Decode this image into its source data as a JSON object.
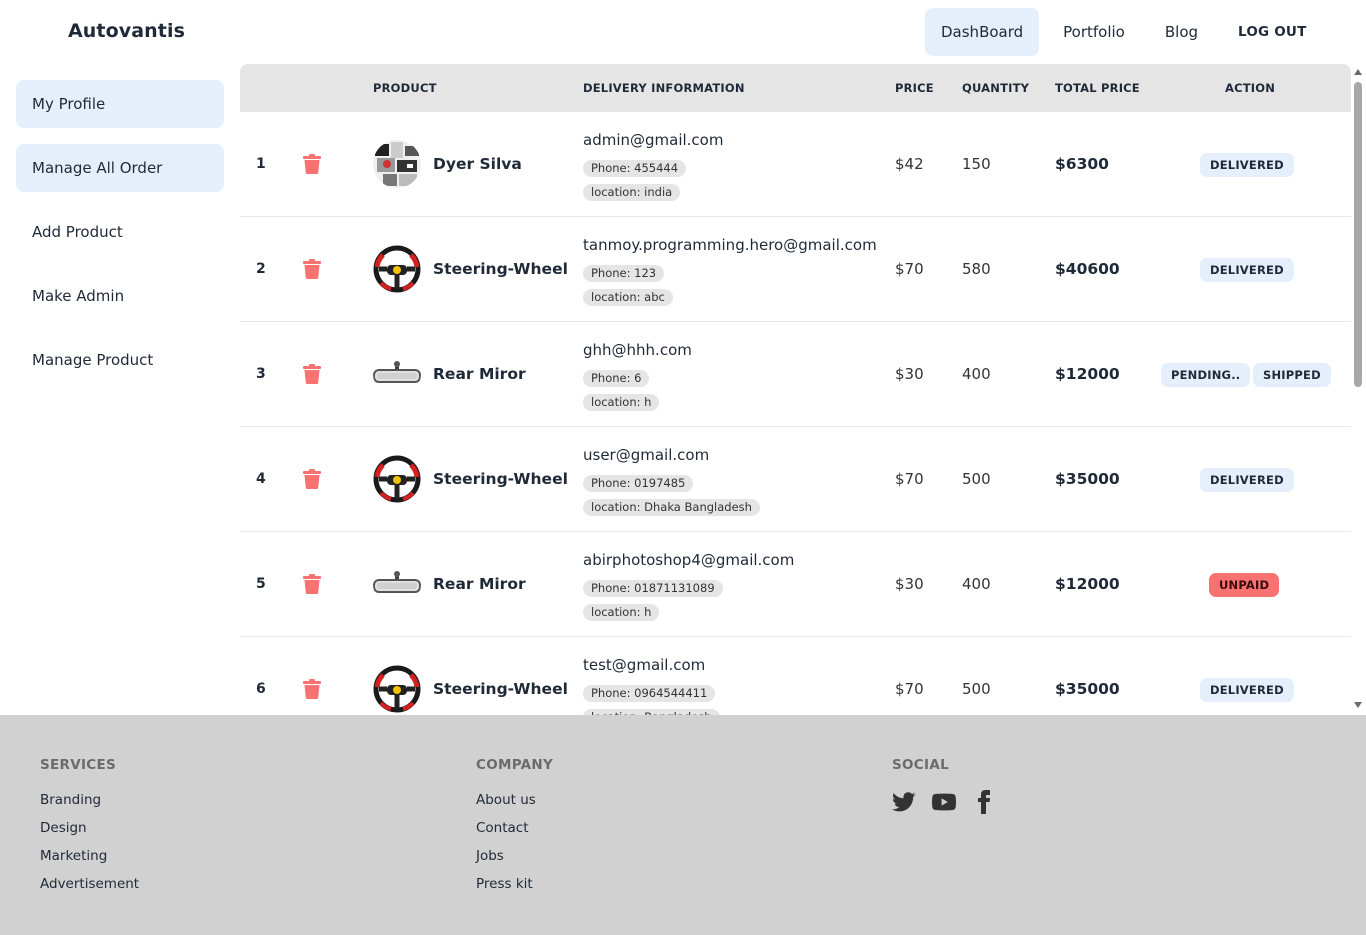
{
  "header": {
    "brand": "Autovantis",
    "nav": [
      {
        "label": "DashBoard"
      },
      {
        "label": "Portfolio"
      },
      {
        "label": "Blog"
      },
      {
        "label": "LOG OUT"
      }
    ]
  },
  "sidebar": {
    "items": [
      {
        "label": "My Profile"
      },
      {
        "label": "Manage All Order"
      },
      {
        "label": "Add Product"
      },
      {
        "label": "Make Admin"
      },
      {
        "label": "Manage Product"
      }
    ]
  },
  "table": {
    "headers": {
      "product": "PRODUCT",
      "delivery": "DELIVERY INFORMATION",
      "price": "PRICE",
      "quantity": "QUANTITY",
      "total": "TOTAL PRICE",
      "action": "ACTION"
    },
    "rows": [
      {
        "index": "1",
        "product": "Dyer Silva",
        "image": "collage-thumbnail",
        "email": "admin@gmail.com",
        "phone": "Phone: 455444",
        "location": "location: india",
        "price": "$42",
        "quantity": "150",
        "total": "$6300",
        "actions": [
          "DELIVERED"
        ]
      },
      {
        "index": "2",
        "product": "Steering-Wheel",
        "image": "steering-wheel",
        "email": "tanmoy.programming.hero@gmail.com",
        "phone": "Phone: 123",
        "location": "location: abc",
        "price": "$70",
        "quantity": "580",
        "total": "$40600",
        "actions": [
          "DELIVERED"
        ]
      },
      {
        "index": "3",
        "product": "Rear Miror",
        "image": "rear-mirror",
        "email": "ghh@hhh.com",
        "phone": "Phone: 6",
        "location": "location: h",
        "price": "$30",
        "quantity": "400",
        "total": "$12000",
        "actions": [
          "PENDING..",
          "SHIPPED"
        ]
      },
      {
        "index": "4",
        "product": "Steering-Wheel",
        "image": "steering-wheel",
        "email": "user@gmail.com",
        "phone": "Phone: 0197485",
        "location": "location: Dhaka Bangladesh",
        "price": "$70",
        "quantity": "500",
        "total": "$35000",
        "actions": [
          "DELIVERED"
        ]
      },
      {
        "index": "5",
        "product": "Rear Miror",
        "image": "rear-mirror",
        "email": "abirphotoshop4@gmail.com",
        "phone": "Phone: 01871131089",
        "location": "location: h",
        "price": "$30",
        "quantity": "400",
        "total": "$12000",
        "actions": [
          "UNPAID"
        ]
      },
      {
        "index": "6",
        "product": "Steering-Wheel",
        "image": "steering-wheel",
        "email": "test@gmail.com",
        "phone": "Phone: 0964544411",
        "location": "location: Bangladesh",
        "price": "$70",
        "quantity": "500",
        "total": "$35000",
        "actions": [
          "DELIVERED"
        ]
      }
    ]
  },
  "footer": {
    "services": {
      "title": "SERVICES",
      "links": [
        "Branding",
        "Design",
        "Marketing",
        "Advertisement"
      ]
    },
    "company": {
      "title": "COMPANY",
      "links": [
        "About us",
        "Contact",
        "Jobs",
        "Press kit"
      ]
    },
    "social": {
      "title": "SOCIAL",
      "icons": [
        "twitter-icon",
        "youtube-icon",
        "facebook-icon"
      ]
    }
  },
  "colors": {
    "active_bg": "#e5effc",
    "trash": "#f87272",
    "unpaid": "#f87272",
    "header_bg": "#e5e5e5",
    "footer_bg": "#d1d1d1"
  }
}
